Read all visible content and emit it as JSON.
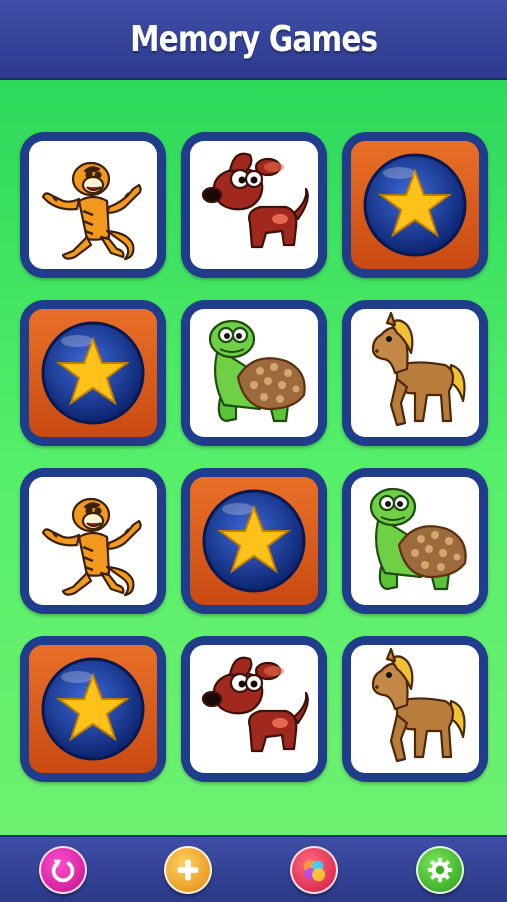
{
  "header": {
    "title": "Memory Games"
  },
  "colors": {
    "header_bg": "#2f3d95",
    "board_green": "#45e866",
    "card_border": "#1f3d8a",
    "card_back": "#d85a1a",
    "star": "#ffc21a"
  },
  "board": {
    "rows": 4,
    "columns": 3,
    "cards": [
      {
        "state": "face-up",
        "animal": "tiger-icon"
      },
      {
        "state": "face-up",
        "animal": "dog-icon"
      },
      {
        "state": "face-down",
        "animal": "star-icon"
      },
      {
        "state": "face-down",
        "animal": "star-icon"
      },
      {
        "state": "face-up",
        "animal": "turtle-icon"
      },
      {
        "state": "face-up",
        "animal": "horse-icon"
      },
      {
        "state": "face-up",
        "animal": "tiger-icon"
      },
      {
        "state": "face-down",
        "animal": "star-icon"
      },
      {
        "state": "face-up",
        "animal": "turtle-icon"
      },
      {
        "state": "face-down",
        "animal": "star-icon"
      },
      {
        "state": "face-up",
        "animal": "dog-icon"
      },
      {
        "state": "face-up",
        "animal": "horse-icon"
      }
    ]
  },
  "footer": {
    "buttons": [
      {
        "icon": "restart-icon",
        "color": "#e01aa8"
      },
      {
        "icon": "plus-icon",
        "color": "#f0a020"
      },
      {
        "icon": "game-center-icon",
        "color": "#e8305a"
      },
      {
        "icon": "settings-gear-icon",
        "color": "#3fbf2a"
      }
    ]
  }
}
